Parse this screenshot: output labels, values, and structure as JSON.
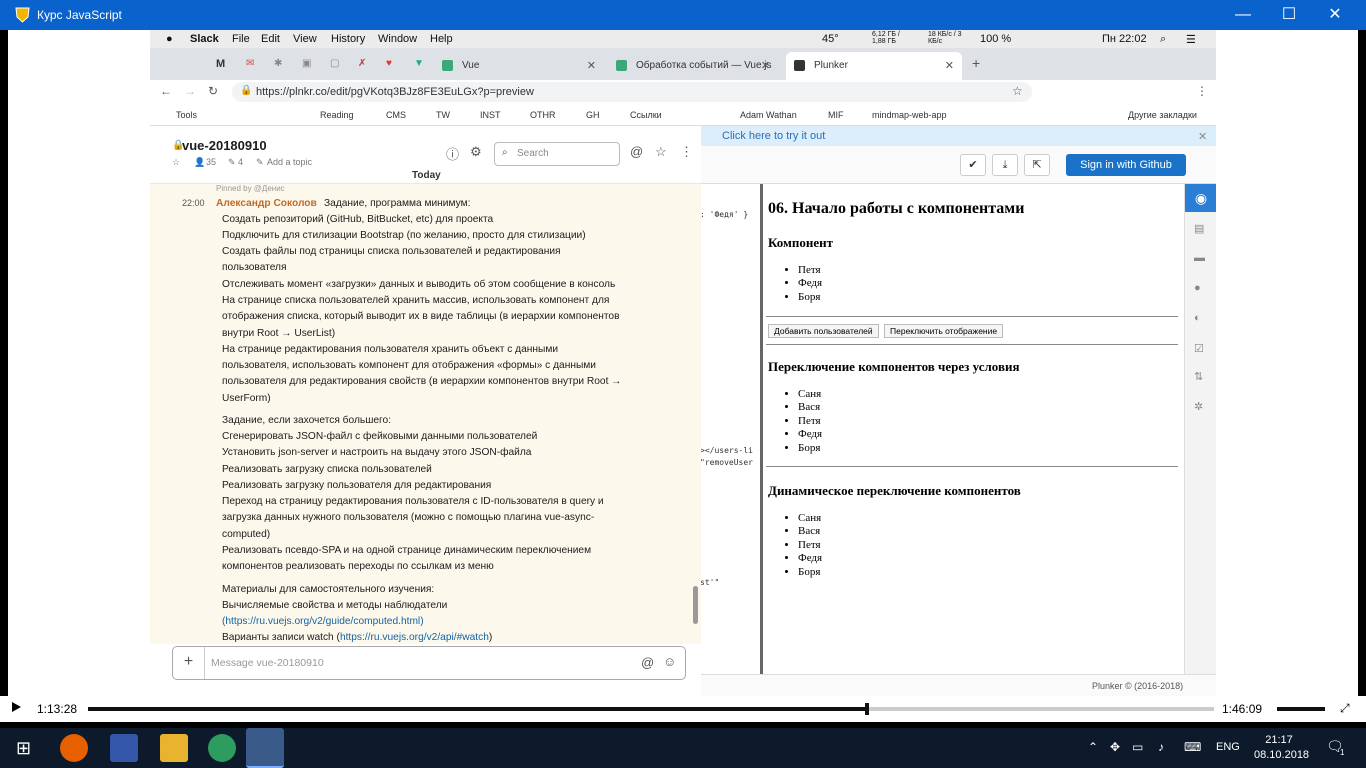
{
  "window": {
    "title": "Курс JavaScript",
    "minimize": "—",
    "maximize": "☐",
    "close": "✕"
  },
  "mac": {
    "apple": "",
    "app": "Slack",
    "menus": [
      "File",
      "Edit",
      "View",
      "History",
      "Window",
      "Help"
    ],
    "temp": "45°",
    "mem": "6,12 ГБ / 1,88 ГБ",
    "net": "18 КБ/с / 3 КБ/с",
    "battery": "100 %",
    "clock": "Пн 22:02"
  },
  "tabs": [
    {
      "label": "Vue"
    },
    {
      "label": "Обработка событий — Vue.js"
    },
    {
      "label": "Plunker"
    }
  ],
  "address": {
    "url": "https://plnkr.co/edit/pgVKotq3BJz8FE3EuLGx?p=preview"
  },
  "bookmarks": {
    "items": [
      "Tools",
      "GH",
      "Reading",
      "CMS",
      "TW",
      "INST",
      "OTHR",
      "GH",
      "Ссылки",
      "Adam Wathan",
      "MIF",
      "mindmap-web-app"
    ],
    "other": "Другие закладки"
  },
  "slack": {
    "channel": "vue-20180910",
    "members": "35",
    "pins": "4",
    "topic": "Add a topic",
    "search_placeholder": "Search",
    "today": "Today",
    "pinned": "Pinned by @Денис",
    "time": "22:00",
    "author": "Александр Соколов",
    "first_line": "Задание, программа минимум:",
    "lines": [
      "Создать репозиторий (GitHub, BitBucket, etc) для проекта",
      "Подключить для стилизации Bootstrap (по желанию, просто для стилизации)",
      "Создать файлы под страницы списка пользователей и редактирования",
      "пользователя",
      "Отслеживать момент «загрузки» данных и выводить об этом сообщение в консоль",
      "На странице списка пользователей хранить массив, использовать компонент для",
      "отображения списка, который выводит их в виде таблицы (в иерархии компонентов",
      "внутри Root → UserList)",
      "На странице редактирования пользователя хранить объект с данными",
      "пользователя, использовать компонент для отображения «формы» с данными",
      "пользователя для редактирования свойств (в иерархии компонентов внутри Root →",
      "UserForm)",
      "Задание, если захочется большего:",
      "Сгенерировать JSON-файл с фейковыми данными пользователей",
      "Установить json-server и настроить на выдачу этого JSON-файла",
      "Реализовать загрузку списка пользователей",
      "Реализовать загрузку пользователя для редактирования",
      "Переход на страницу редактирования пользователя с ID-пользователя в query и",
      "загрузка данных нужного пользователя (можно с помощью плагина vue-async-",
      "computed)",
      "Реализовать псевдо-SPA и на одной странице динамическим переключением",
      "компонентов реализовать переходы по ссылкам из меню",
      "Материалы для самостоятельного изучения:",
      "Вычисляемые свойства и методы наблюдатели"
    ],
    "link1": "(https://ru.vuejs.org/v2/guide/computed.html)",
    "watch_prefix": "Варианты записи watch (",
    "link2": "https://ru.vuejs.org/v2/api/#watch",
    "watch_suffix": ")",
    "composer_placeholder": "Message vue-20180910"
  },
  "plunker": {
    "banner": "Click here to try it out",
    "signin": "Sign in with Github",
    "code": [
      ": 'Федя' }",
      "></users-li",
      "\"removeUser",
      "st'\""
    ],
    "title": "06. Начало работы с компонентами",
    "h_component": "Компонент",
    "list1": [
      "Петя",
      "Федя",
      "Боря"
    ],
    "btn_add": "Добавить пользователей",
    "btn_toggle": "Переключить отображение",
    "h_cond": "Переключение компонентов через условия",
    "list2": [
      "Саня",
      "Вася",
      "Петя",
      "Федя",
      "Боря"
    ],
    "h_dyn": "Динамическое переключение компонентов",
    "list3": [
      "Саня",
      "Вася",
      "Петя",
      "Федя",
      "Боря"
    ],
    "footer": "Plunker © (2016-2018)"
  },
  "player": {
    "current": "1:13:28",
    "total": "1:46:09",
    "progress": 0.692
  },
  "taskbar": {
    "lang": "ENG",
    "time": "21:17",
    "date": "08.10.2018",
    "notif": "1"
  }
}
